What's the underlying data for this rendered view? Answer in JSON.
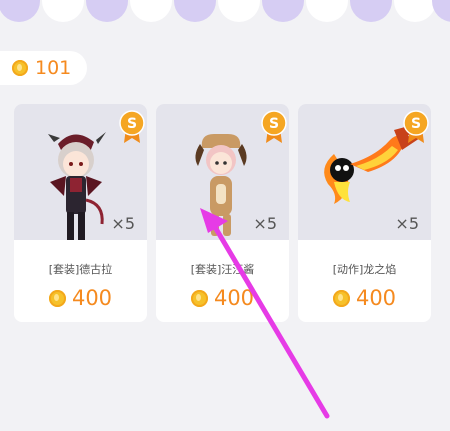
{
  "colors": {
    "accent": "#f58a1f",
    "scallop_purple": "#d6cdf3",
    "scallop_white": "#ffffff",
    "card_bg": "#ffffff",
    "thumb_bg": "#e4e4ec",
    "badge": "#f5a623",
    "annotation_arrow": "#e63be6"
  },
  "balance": {
    "icon": "coin-icon",
    "count": "101"
  },
  "items": [
    {
      "badge": "S",
      "quantity": "×5",
      "name": "[套装]德古拉",
      "price": "400",
      "image": "vampire-costume"
    },
    {
      "badge": "S",
      "quantity": "×5",
      "name": "[套装]汪汪酱",
      "price": "400",
      "image": "puppy-costume"
    },
    {
      "badge": "S",
      "quantity": "×5",
      "name": "[动作]龙之焰",
      "price": "400",
      "image": "dragon-flame-action"
    }
  ]
}
